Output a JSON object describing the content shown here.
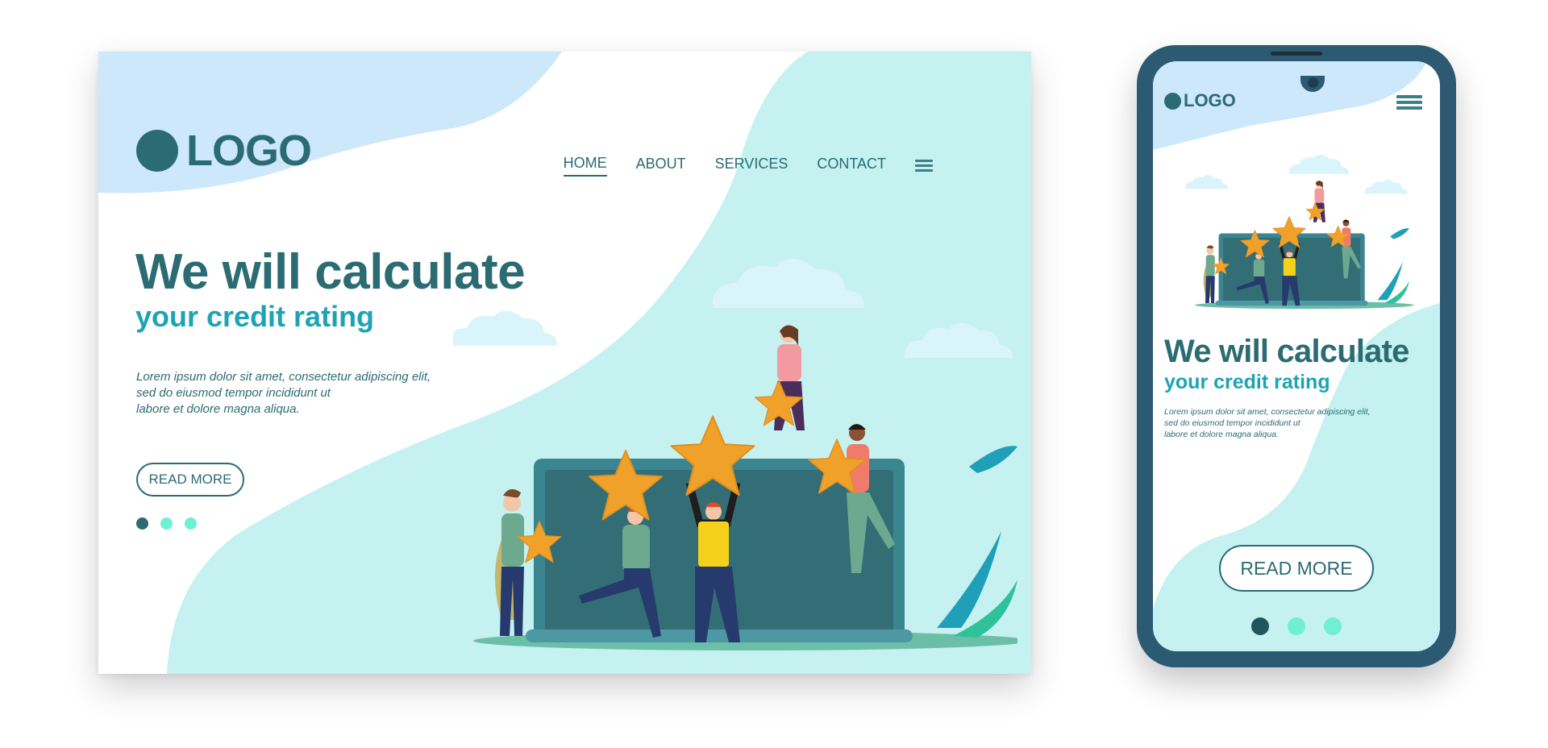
{
  "colors": {
    "primary": "#2b6b72",
    "accent": "#1ea3b4",
    "bg_blue": "#cde7fb",
    "bg_teal": "#c5f1f1",
    "dot_active": "#2b6b72",
    "dot_inactive": "#6ff0d4",
    "star": "#f0a12a",
    "laptop": "#336e76",
    "phone_frame": "#2c5a73"
  },
  "desktop": {
    "logo": {
      "icon": "circle-logo-icon",
      "text": "LOGO"
    },
    "nav": {
      "items": [
        {
          "label": "HOME",
          "active": true
        },
        {
          "label": "ABOUT",
          "active": false
        },
        {
          "label": "SERVICES",
          "active": false
        },
        {
          "label": "CONTACT",
          "active": false
        }
      ],
      "menu_icon": "hamburger-menu-icon"
    },
    "hero": {
      "headline": "We will calculate",
      "subheadline": "your credit rating",
      "body_lines": [
        "Lorem ipsum dolor sit amet, consectetur adipiscing elit,",
        "sed do eiusmod tempor incididunt ut",
        "labore et dolore magna aliqua."
      ],
      "cta_label": "READ MORE",
      "slider": {
        "count": 3,
        "active_index": 0
      }
    },
    "illustration": "people-holding-rating-stars-laptop"
  },
  "mobile": {
    "logo": {
      "icon": "circle-logo-icon",
      "text": "LOGO"
    },
    "menu_icon": "hamburger-menu-icon",
    "hero": {
      "headline": "We will calculate",
      "subheadline": "your credit rating",
      "body_lines": [
        "Lorem ipsum dolor sit amet, consectetur adipiscing elit,",
        "sed do eiusmod tempor incididunt ut",
        "labore et dolore magna aliqua."
      ],
      "cta_label": "READ MORE",
      "slider": {
        "count": 3,
        "active_index": 0
      }
    },
    "illustration": "people-holding-rating-stars-laptop"
  }
}
